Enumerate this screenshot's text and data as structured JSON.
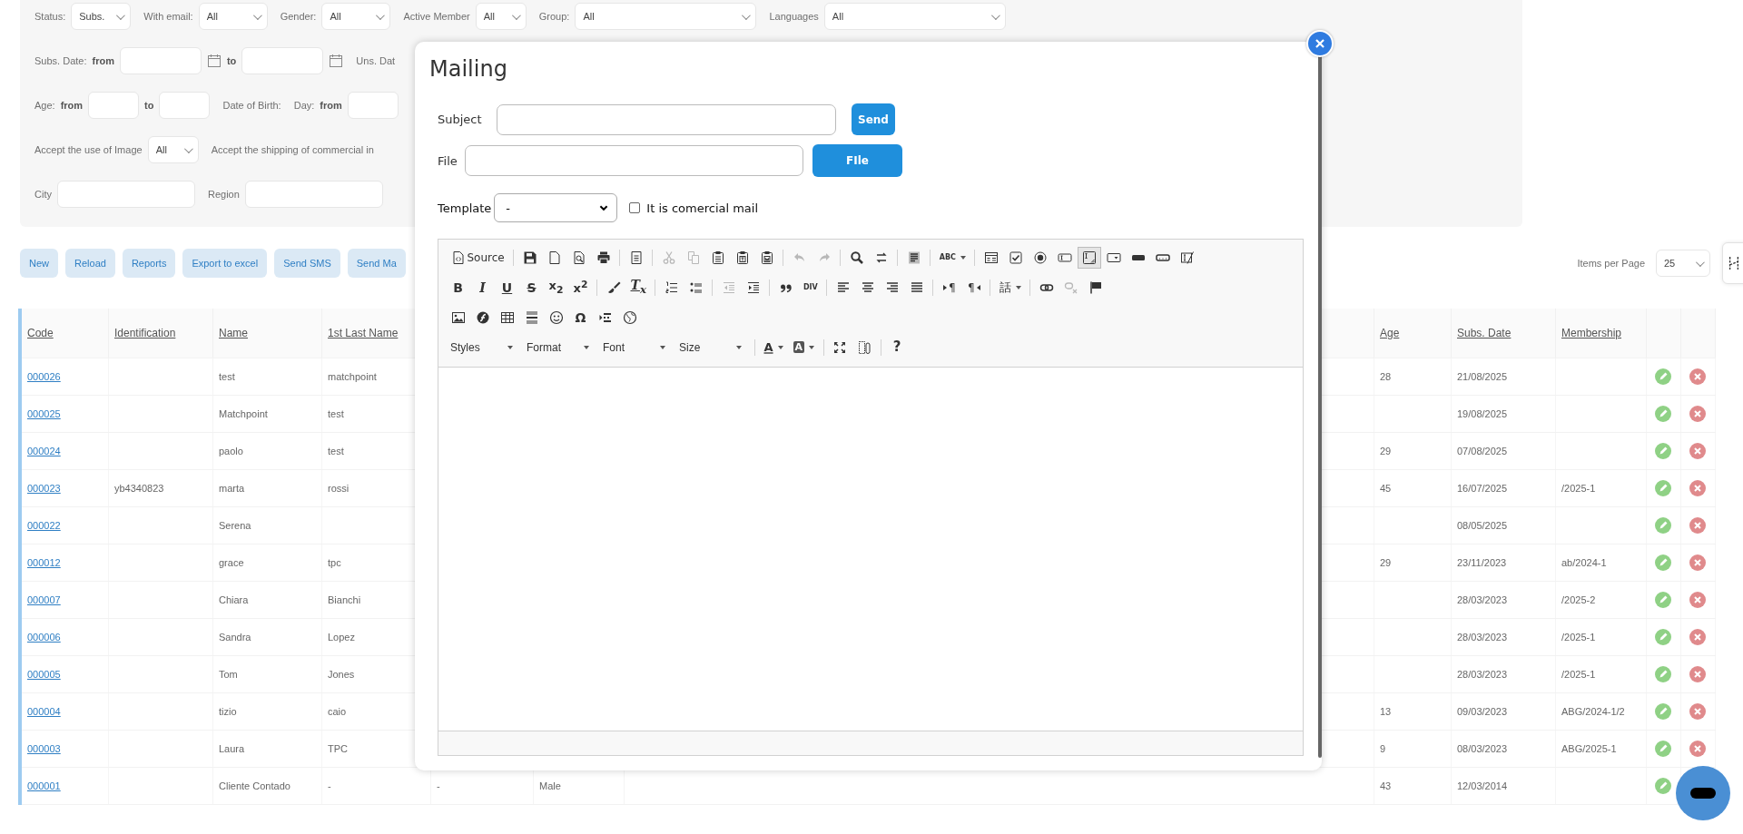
{
  "filters": [
    {
      "fields": [
        {
          "label": "Status:",
          "kind": "select",
          "value": "Subs."
        },
        {
          "label": "With email:",
          "kind": "select",
          "value": "All"
        },
        {
          "label": "Gender:",
          "kind": "select",
          "value": "All"
        },
        {
          "label": "Active Member",
          "kind": "select",
          "value": "All"
        },
        {
          "label": "Group:",
          "kind": "wideselect",
          "value": "All"
        },
        {
          "label": "Languages",
          "kind": "wideselect",
          "value": "All"
        }
      ]
    },
    {
      "fields": [
        {
          "label": "Subs. Date:",
          "kind": "daterange",
          "from": "from",
          "to": "to"
        },
        {
          "label": "Uns. Dat",
          "kind": "cut"
        }
      ]
    },
    {
      "fields": [
        {
          "label": "Age:",
          "kind": "range",
          "from": "from",
          "to": "to"
        },
        {
          "label": "Date of Birth:",
          "kind": "dob",
          "day": "Day:",
          "from": "from"
        }
      ]
    },
    {
      "fields": [
        {
          "label": "Accept the use of Image",
          "kind": "select",
          "value": "All"
        },
        {
          "label": "Accept the shipping of commercial in",
          "kind": "cut"
        }
      ]
    },
    {
      "fields": [
        {
          "label": "City",
          "kind": "text"
        },
        {
          "label": "Region",
          "kind": "text"
        }
      ]
    }
  ],
  "actions": {
    "buttons": [
      "New",
      "Reload",
      "Reports",
      "Export to excel",
      "Send SMS",
      "Send Ma"
    ],
    "per_page": {
      "label": "Items per Page",
      "value": "25"
    }
  },
  "table": {
    "columns": [
      "Code",
      "Identification",
      "Name",
      "1st Last Name",
      "Age",
      "Subs. Date",
      "Membership"
    ],
    "rows": [
      {
        "code": "000026",
        "name": "test",
        "last_name": "matchpoint",
        "age": "28",
        "subs_date": "21/08/2025",
        "actions": [
          {
            "kind": "edit"
          },
          {
            "kind": "delete"
          }
        ]
      },
      {
        "code": "000025",
        "name": "Matchpoint",
        "last_name": "test",
        "subs_date": "19/08/2025",
        "actions": [
          {
            "kind": "edit"
          },
          {
            "kind": "delete"
          }
        ]
      },
      {
        "code": "000024",
        "name": "paolo",
        "last_name": "test",
        "age": "29",
        "subs_date": "07/08/2025",
        "actions": [
          {
            "kind": "edit"
          },
          {
            "kind": "delete"
          }
        ]
      },
      {
        "code": "000023",
        "identification": "yb4340823",
        "name": "marta",
        "last_name": "rossi",
        "age": "45",
        "subs_date": "16/07/2025",
        "membership": "/2025-1",
        "actions": [
          {
            "kind": "edit"
          },
          {
            "kind": "delete"
          }
        ]
      },
      {
        "code": "000022",
        "name": "Serena",
        "subs_date": "08/05/2025",
        "actions": [
          {
            "kind": "edit"
          },
          {
            "kind": "delete"
          }
        ]
      },
      {
        "code": "000012",
        "name": "grace",
        "last_name": "tpc",
        "age": "29",
        "subs_date": "23/11/2023",
        "membership": "ab/2024-1",
        "actions": [
          {
            "kind": "edit"
          },
          {
            "kind": "delete"
          }
        ]
      },
      {
        "code": "000007",
        "name": "Chiara",
        "last_name": "Bianchi",
        "subs_date": "28/03/2023",
        "membership": "/2025-2",
        "actions": [
          {
            "kind": "edit"
          },
          {
            "kind": "delete"
          }
        ]
      },
      {
        "code": "000006",
        "name": "Sandra",
        "last_name": "Lopez",
        "subs_date": "28/03/2023",
        "membership": "/2025-1",
        "actions": [
          {
            "kind": "edit"
          },
          {
            "kind": "delete"
          }
        ]
      },
      {
        "code": "000005",
        "name": "Tom",
        "last_name": "Jones",
        "subs_date": "28/03/2023",
        "membership": "/2025-1",
        "actions": [
          {
            "kind": "edit"
          },
          {
            "kind": "delete"
          }
        ]
      },
      {
        "code": "000004",
        "name": "tizio",
        "last_name": "caio",
        "age": "13",
        "subs_date": "09/03/2023",
        "membership": "ABG/2024-1/2",
        "actions": [
          {
            "kind": "edit"
          },
          {
            "kind": "delete"
          }
        ]
      },
      {
        "code": "000003",
        "name": "Laura",
        "last_name": "TPC",
        "age": "9",
        "subs_date": "08/03/2023",
        "membership": "ABG/2025-1",
        "actions": [
          {
            "kind": "edit"
          },
          {
            "kind": "delete"
          }
        ]
      },
      {
        "code": "000001",
        "name": "Cliente Contado",
        "last_name": "-",
        "column_5": "-",
        "column_6": "Male",
        "age": "43",
        "subs_date": "12/03/2014",
        "actions": [
          {
            "kind": "edit"
          }
        ]
      }
    ]
  },
  "mailing": {
    "title": "Mailing",
    "subject": {
      "label": "Subject"
    },
    "send_button": "Send",
    "file": {
      "label": "File"
    },
    "file_button": "FIle",
    "template": {
      "label": "Template",
      "value": "-"
    },
    "commercial": {
      "label": "It is comercial mail",
      "checked": false
    },
    "toolbar": [
      [
        [
          {
            "kind": "source",
            "label": "Source",
            "disabled": false,
            "on": false
          }
        ],
        [
          {
            "kind": "save",
            "disabled": false,
            "on": false
          },
          {
            "kind": "newpage",
            "disabled": false,
            "on": false
          },
          {
            "kind": "preview",
            "disabled": false,
            "on": false
          },
          {
            "kind": "print",
            "disabled": false,
            "on": false
          }
        ],
        [
          {
            "kind": "templates",
            "disabled": false,
            "on": false
          }
        ],
        [
          {
            "kind": "cut",
            "disabled": true,
            "on": false
          },
          {
            "kind": "copy",
            "disabled": true,
            "on": false
          },
          {
            "kind": "paste",
            "disabled": false,
            "on": false
          },
          {
            "kind": "pastetext",
            "disabled": false,
            "on": false
          },
          {
            "kind": "pasteword",
            "disabled": false,
            "on": false
          }
        ],
        [
          {
            "kind": "undo",
            "disabled": true,
            "on": false
          },
          {
            "kind": "redo",
            "disabled": true,
            "on": false
          }
        ],
        [
          {
            "kind": "find",
            "disabled": false,
            "on": false
          },
          {
            "kind": "replace",
            "disabled": false,
            "on": false
          }
        ],
        [
          {
            "kind": "selectall",
            "disabled": false,
            "on": false
          }
        ],
        [
          {
            "kind": "spell",
            "glyph": "ABC",
            "disabled": false,
            "on": false
          }
        ],
        [
          {
            "kind": "form",
            "disabled": false,
            "on": false
          },
          {
            "kind": "checkbox",
            "disabled": false,
            "on": false
          },
          {
            "kind": "radio",
            "disabled": false,
            "on": false
          },
          {
            "kind": "textfield",
            "disabled": false,
            "on": false
          },
          {
            "kind": "textarea",
            "disabled": false,
            "on": true
          },
          {
            "kind": "select",
            "disabled": false,
            "on": false
          },
          {
            "kind": "button",
            "disabled": false,
            "on": false
          },
          {
            "kind": "imagebutton",
            "disabled": false,
            "on": false
          },
          {
            "kind": "hidden",
            "disabled": false,
            "on": false
          }
        ]
      ],
      [
        [
          {
            "kind": "bold",
            "glyph": "B",
            "disabled": false,
            "on": false
          },
          {
            "kind": "italic",
            "glyph": "I",
            "disabled": false,
            "on": false
          },
          {
            "kind": "underline",
            "glyph": "U",
            "disabled": false,
            "on": false
          },
          {
            "kind": "strike",
            "glyph": "S",
            "disabled": false,
            "on": false
          },
          {
            "kind": "sub",
            "glyph": "x$_{2}$",
            "disabled": false,
            "on": false
          },
          {
            "kind": "sup",
            "glyph": "x$^{2}$",
            "disabled": false,
            "on": false
          }
        ],
        [
          {
            "kind": "brush",
            "disabled": false,
            "on": false
          },
          {
            "kind": "removeformat",
            "glyph": "T$_{x}$",
            "disabled": false,
            "on": false
          }
        ],
        [
          {
            "kind": "ol",
            "disabled": false,
            "on": false
          },
          {
            "kind": "ul",
            "disabled": false,
            "on": false
          }
        ],
        [
          {
            "kind": "outdent",
            "disabled": true,
            "on": false
          },
          {
            "kind": "indent",
            "disabled": false,
            "on": false
          }
        ],
        [
          {
            "kind": "quote",
            "disabled": false,
            "on": false
          },
          {
            "kind": "div",
            "glyph": "DIV",
            "disabled": false,
            "on": false
          }
        ],
        [
          {
            "kind": "left",
            "disabled": false,
            "on": false
          },
          {
            "kind": "center",
            "disabled": false,
            "on": false
          },
          {
            "kind": "right",
            "disabled": false,
            "on": false
          },
          {
            "kind": "justify",
            "disabled": false,
            "on": false
          }
        ],
        [
          {
            "kind": "ltr",
            "glyph": "¶",
            "disabled": false,
            "on": false
          },
          {
            "kind": "rtl",
            "glyph": "¶",
            "disabled": false,
            "on": false
          }
        ],
        [
          {
            "kind": "lang",
            "glyph": "話",
            "disabled": false,
            "on": false
          }
        ],
        [
          {
            "kind": "link",
            "disabled": false,
            "on": false
          },
          {
            "kind": "unlink",
            "disabled": true,
            "on": false
          },
          {
            "kind": "anchor",
            "disabled": false,
            "on": false
          }
        ]
      ],
      [
        [
          {
            "kind": "image",
            "disabled": false,
            "on": false
          },
          {
            "kind": "flash",
            "disabled": false,
            "on": false
          },
          {
            "kind": "table",
            "disabled": false,
            "on": false
          },
          {
            "kind": "hr",
            "disabled": false,
            "on": false
          },
          {
            "kind": "smiley",
            "disabled": false,
            "on": false
          },
          {
            "kind": "special",
            "glyph": "Ω",
            "disabled": false,
            "on": false
          },
          {
            "kind": "pagebreak",
            "disabled": false,
            "on": false
          },
          {
            "kind": "iframe",
            "disabled": false,
            "on": false
          }
        ]
      ],
      [
        [
          {
            "kind": "combo",
            "label": "Styles",
            "disabled": false,
            "on": false
          },
          {
            "kind": "combo",
            "label": "Format",
            "disabled": false,
            "on": false
          },
          {
            "kind": "combo",
            "label": "Font",
            "disabled": false,
            "on": false
          },
          {
            "kind": "combo",
            "label": "Size",
            "disabled": false,
            "on": false
          }
        ],
        [
          {
            "kind": "fg",
            "glyph": "A",
            "disabled": false,
            "on": false
          },
          {
            "kind": "bg",
            "glyph": "A",
            "disabled": false,
            "on": false
          }
        ],
        [
          {
            "kind": "max",
            "disabled": false,
            "on": false
          },
          {
            "kind": "blocks",
            "disabled": false,
            "on": false
          }
        ],
        [
          {
            "kind": "help",
            "glyph": "?",
            "disabled": false,
            "on": false
          }
        ]
      ]
    ]
  }
}
